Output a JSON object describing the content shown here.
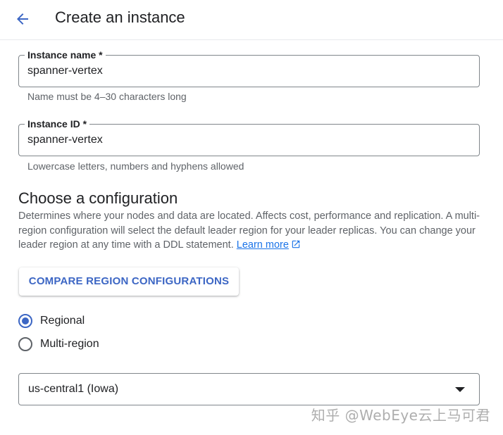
{
  "header": {
    "back_icon": "arrow-back-icon",
    "title": "Create an instance"
  },
  "instance_name": {
    "label": "Instance name *",
    "value": "spanner-vertex",
    "hint": "Name must be 4–30 characters long"
  },
  "instance_id": {
    "label": "Instance ID *",
    "value": "spanner-vertex",
    "hint": "Lowercase letters, numbers and hyphens allowed"
  },
  "configuration": {
    "title": "Choose a configuration",
    "description": "Determines where your nodes and data are located. Affects cost, performance and replication. A multi-region configuration will select the default leader region for your leader replicas. You can change your leader region at any time with a DDL statement.",
    "learn_more": "Learn more",
    "learn_more_icon": "external-link-icon",
    "compare_button": "COMPARE REGION CONFIGURATIONS",
    "options": [
      {
        "label": "Regional",
        "selected": true
      },
      {
        "label": "Multi-region",
        "selected": false
      }
    ],
    "region_select": {
      "value": "us-central1 (Iowa)",
      "icon": "dropdown-arrow-icon"
    }
  },
  "watermark": "知乎 @WebEye云上马可君",
  "colors": {
    "accent": "#3c66c4",
    "link": "#1a73e8",
    "text": "#202124",
    "secondary_text": "#5f6368",
    "border": "#80868b"
  }
}
